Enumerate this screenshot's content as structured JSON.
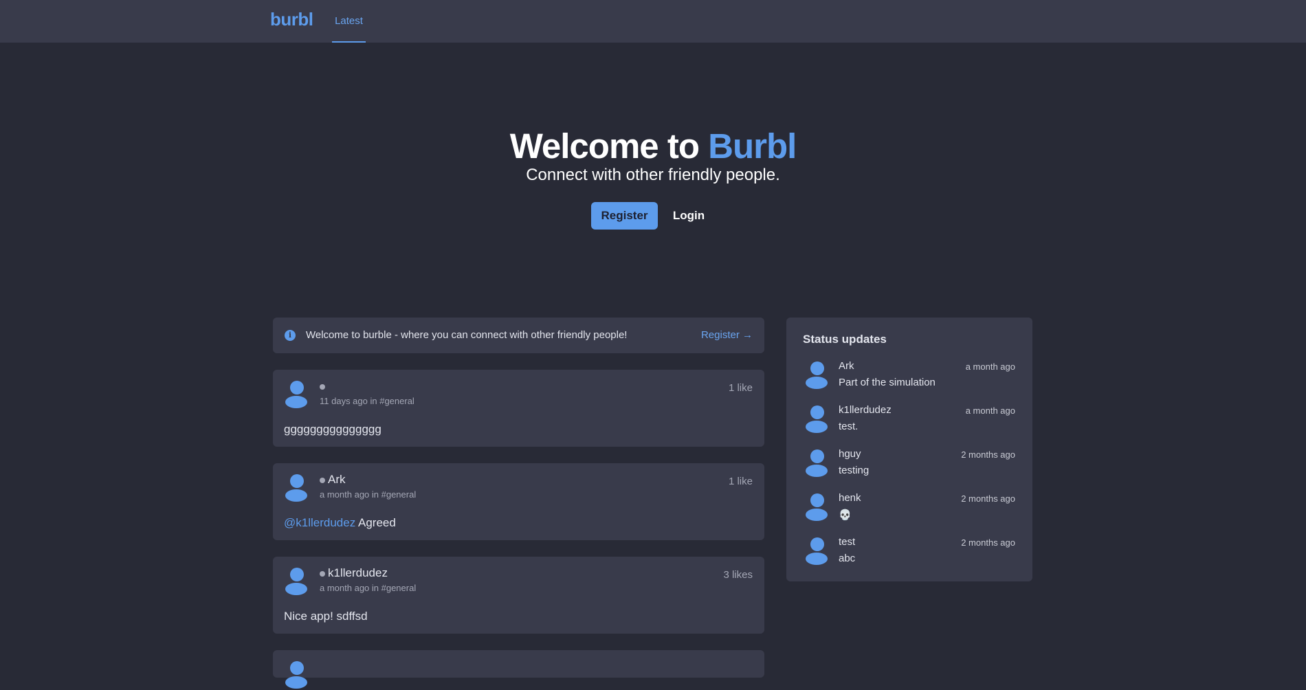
{
  "header": {
    "brand": "burbl",
    "tabs": [
      {
        "label": "Latest"
      }
    ]
  },
  "hero": {
    "title_prefix": "Welcome to ",
    "title_accent": "Burbl",
    "subtitle": "Connect with other friendly people.",
    "register_label": "Register",
    "login_label": "Login"
  },
  "banner": {
    "icon": "info-icon",
    "text": "Welcome to burble - where you can connect with other friendly people!",
    "link_label": "Register →"
  },
  "posts": [
    {
      "author": "",
      "meta": "11 days ago in #general",
      "likes": "1 like",
      "mention": "",
      "content": "ggggggggggggggg"
    },
    {
      "author": "Ark",
      "meta": "a month ago in #general",
      "likes": "1 like",
      "mention": "@k1llerdudez",
      "content": " Agreed"
    },
    {
      "author": "k1llerdudez",
      "meta": "a month ago in #general",
      "likes": "3 likes",
      "mention": "",
      "content": "Nice app! sdffsd"
    }
  ],
  "status_updates": {
    "title": "Status updates",
    "items": [
      {
        "name": "Ark",
        "time": "a month ago",
        "text": "Part of the simulation"
      },
      {
        "name": "k1llerdudez",
        "time": "a month ago",
        "text": "test."
      },
      {
        "name": "hguy",
        "time": "2 months ago",
        "text": "testing"
      },
      {
        "name": "henk",
        "time": "2 months ago",
        "text": "💀"
      },
      {
        "name": "test",
        "time": "2 months ago",
        "text": "abc"
      }
    ]
  },
  "colors": {
    "accent": "#5d9cec",
    "background": "#282a36",
    "card": "#393b4b"
  }
}
